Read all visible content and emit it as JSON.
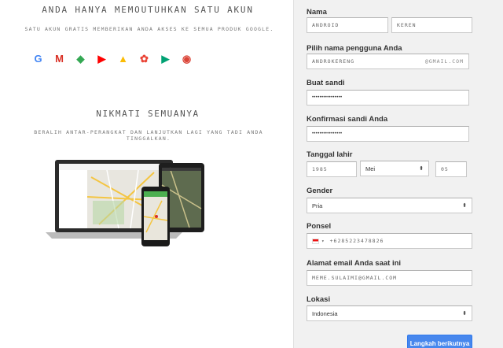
{
  "promo": {
    "heading1": "Anda hanya memoutuhkan satu akun",
    "subheading1": "Satu akun gratis memberikan Anda akses ke semua produk Google.",
    "icons": [
      {
        "name": "google-icon",
        "glyph": "G",
        "color": "#4285f4"
      },
      {
        "name": "gmail-icon",
        "glyph": "M",
        "color": "#d93025"
      },
      {
        "name": "maps-icon",
        "glyph": "◆",
        "color": "#34a853"
      },
      {
        "name": "youtube-icon",
        "glyph": "▶",
        "color": "#ff0000"
      },
      {
        "name": "drive-icon",
        "glyph": "▲",
        "color": "#fbbc05"
      },
      {
        "name": "photos-icon",
        "glyph": "✿",
        "color": "#ea4335"
      },
      {
        "name": "play-icon",
        "glyph": "▶",
        "color": "#00a173"
      },
      {
        "name": "chrome-icon",
        "glyph": "◉",
        "color": "#db4437"
      }
    ],
    "heading2": "Nikmati semuanya",
    "subheading2": "Beralih antar-perangkat dan lanjutkan lagi yang tadi Anda tinggalkan."
  },
  "form": {
    "name_label": "Nama",
    "first_name": "ANDROID",
    "last_name": "KEREN",
    "username_label": "Pilih nama pengguna Anda",
    "username": "ANDROKERENG",
    "username_suffix": "@gmail.com",
    "password_label": "Buat sandi",
    "password": "••••••••••••••••",
    "confirm_label": "Konfirmasi sandi Anda",
    "confirm": "••••••••••••••••",
    "dob_label": "Tanggal lahir",
    "dob_day": "1985",
    "dob_month": "Mei",
    "dob_year": "05",
    "gender_label": "Gender",
    "gender": "Pria",
    "phone_label": "Ponsel",
    "phone": "+6285223478826",
    "email_label": "Alamat email Anda saat ini",
    "email": "MEME.SULAIMI@GMAIL.COM",
    "location_label": "Lokasi",
    "location": "Indonesia",
    "next_button": "Langkah berikutnya"
  }
}
